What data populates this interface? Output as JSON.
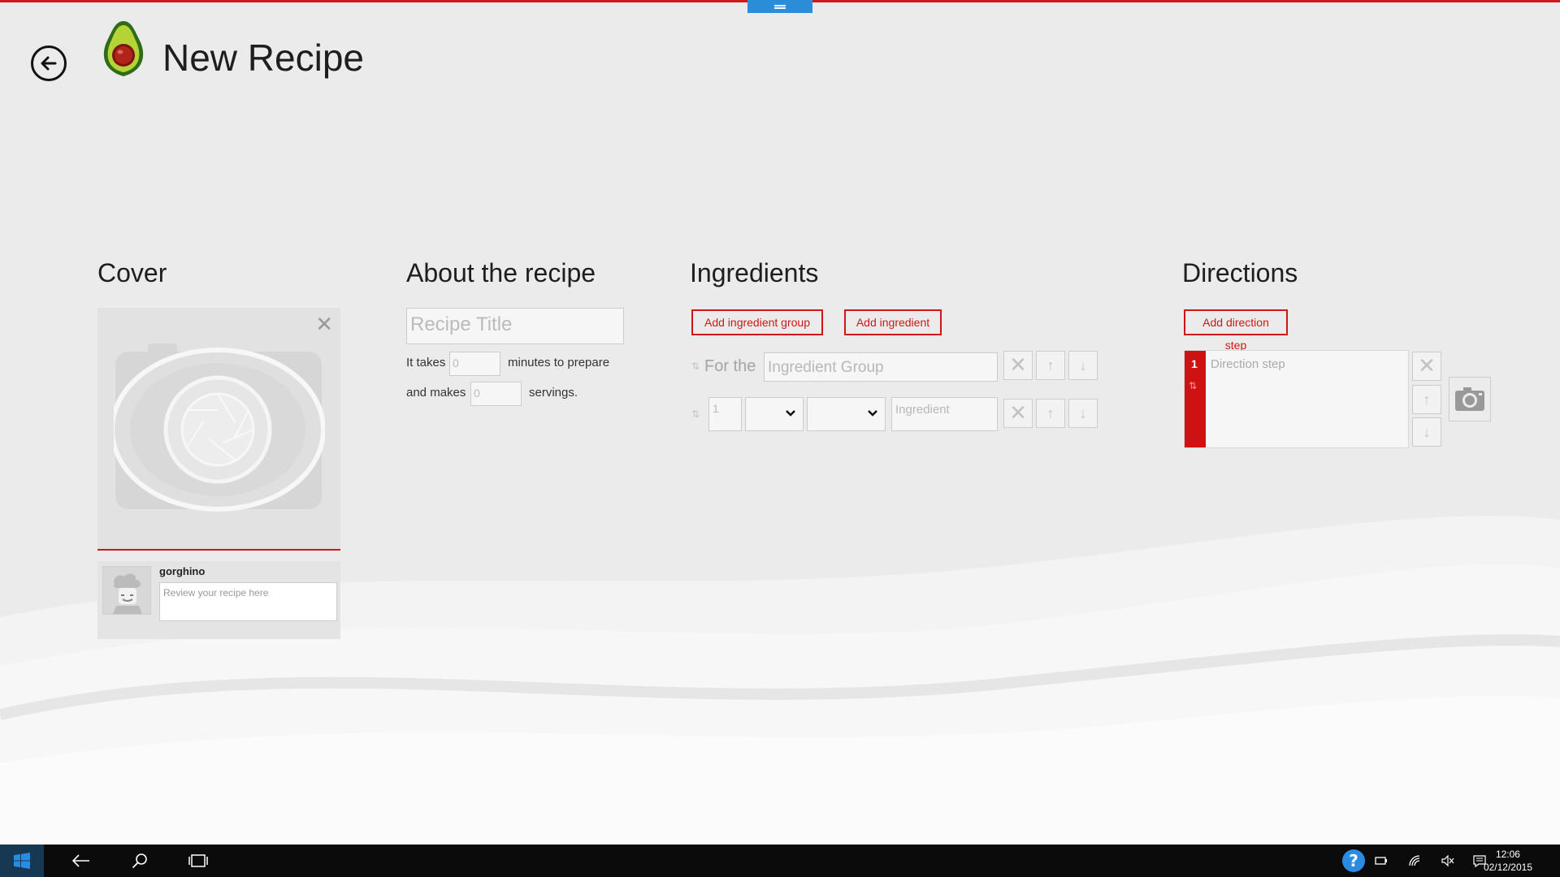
{
  "header": {
    "title": "New Recipe"
  },
  "cover": {
    "heading": "Cover",
    "review": {
      "username": "gorghino",
      "placeholder": "Review your recipe here"
    }
  },
  "about": {
    "heading": "About the recipe",
    "title_placeholder": "Recipe Title",
    "it_takes": "It takes",
    "minutes_value": "0",
    "minutes_to_prepare": "minutes to prepare",
    "and_makes": "and makes",
    "servings_value": "0",
    "servings": "servings."
  },
  "ingredients": {
    "heading": "Ingredients",
    "add_group_label": "Add ingredient group",
    "add_ingredient_label": "Add ingredient",
    "for_the": "For the",
    "group_placeholder": "Ingredient Group",
    "quantity_value": "1",
    "ingredient_placeholder": "Ingredient"
  },
  "directions": {
    "heading": "Directions",
    "add_step_label": "Add direction step",
    "step_number": "1",
    "step_placeholder": "Direction step"
  },
  "taskbar": {
    "time": "12:06",
    "date": "02/12/2015"
  },
  "colors": {
    "accent": "#cf1717",
    "handle": "#2b8cd8",
    "taskbar": "#0b0b0b"
  },
  "icons": [
    "back-arrow-icon",
    "avocado-logo-icon",
    "close-icon",
    "camera-icon",
    "chef-avatar-icon",
    "chevron-down-icon",
    "arrow-up-icon",
    "arrow-down-icon",
    "windows-start-icon",
    "search-icon",
    "task-view-icon",
    "help-icon",
    "battery-icon",
    "wifi-icon",
    "volume-icon",
    "notification-icon"
  ]
}
